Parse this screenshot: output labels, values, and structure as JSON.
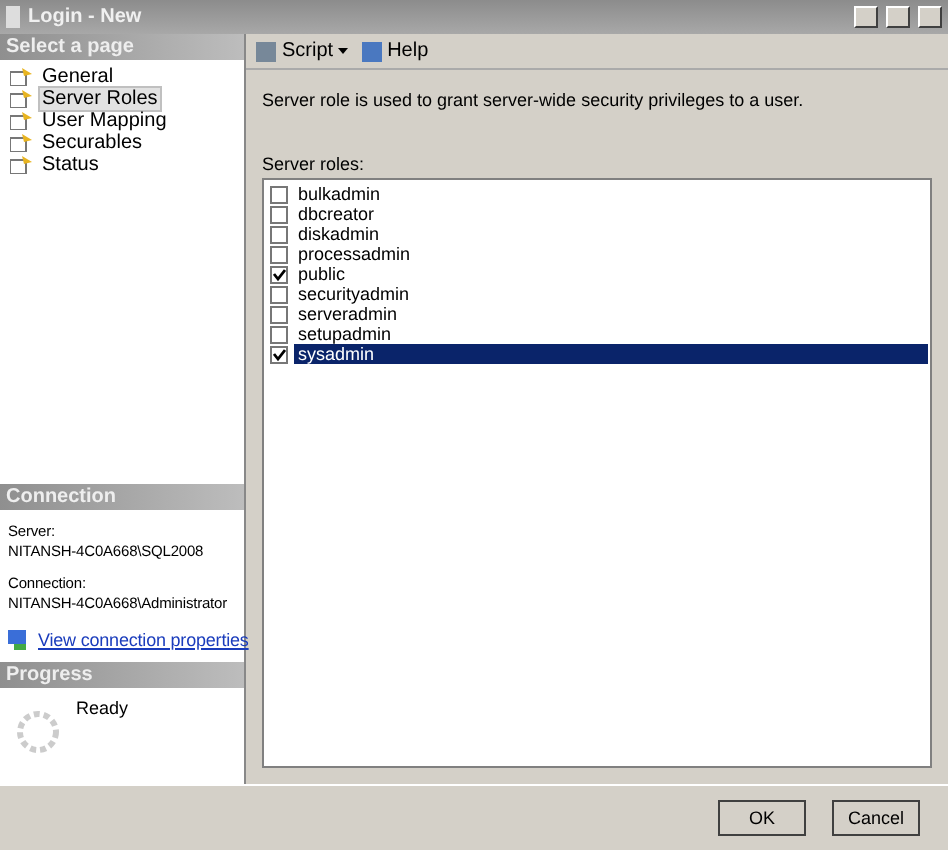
{
  "window": {
    "title": "Login - New"
  },
  "sidebar": {
    "header": "Select a page",
    "items": [
      {
        "label": "General",
        "selected": false
      },
      {
        "label": "Server Roles",
        "selected": true
      },
      {
        "label": "User Mapping",
        "selected": false
      },
      {
        "label": "Securables",
        "selected": false
      },
      {
        "label": "Status",
        "selected": false
      }
    ]
  },
  "connection": {
    "header": "Connection",
    "server_label": "Server:",
    "server": "NITANSH-4C0A668\\SQL2008",
    "connection_label": "Connection:",
    "connection": "NITANSH-4C0A668\\Administrator",
    "link": "View connection properties"
  },
  "progress": {
    "header": "Progress",
    "status": "Ready"
  },
  "toolbar": {
    "script": "Script",
    "help": "Help"
  },
  "description": "Server role is used to grant server-wide security privileges to a user.",
  "roles_label": "Server roles:",
  "roles": [
    {
      "name": "bulkadmin",
      "checked": false,
      "selected": false
    },
    {
      "name": "dbcreator",
      "checked": false,
      "selected": false
    },
    {
      "name": "diskadmin",
      "checked": false,
      "selected": false
    },
    {
      "name": "processadmin",
      "checked": false,
      "selected": false
    },
    {
      "name": "public",
      "checked": true,
      "selected": false
    },
    {
      "name": "securityadmin",
      "checked": false,
      "selected": false
    },
    {
      "name": "serveradmin",
      "checked": false,
      "selected": false
    },
    {
      "name": "setupadmin",
      "checked": false,
      "selected": false
    },
    {
      "name": "sysadmin",
      "checked": true,
      "selected": true
    }
  ],
  "buttons": [
    "OK",
    "Cancel"
  ]
}
